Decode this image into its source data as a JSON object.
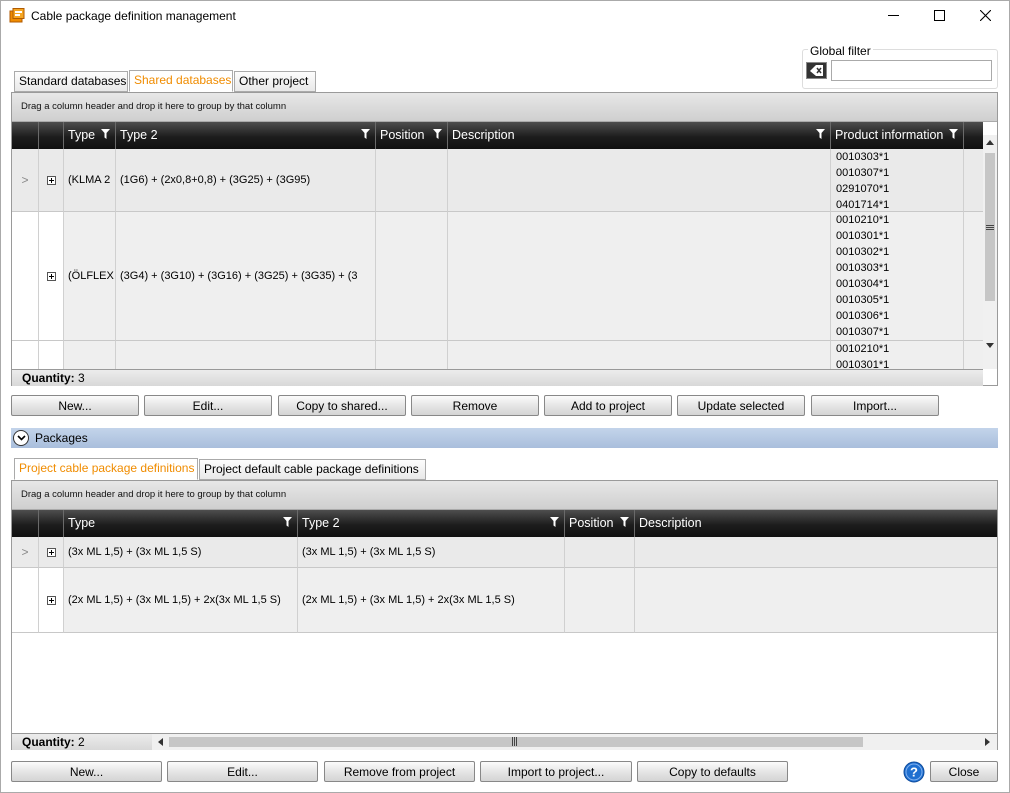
{
  "window": {
    "title": "Cable package definition management",
    "icon": "cable-package-app-icon"
  },
  "global_filter": {
    "label": "Global filter",
    "value": ""
  },
  "top_tabs": [
    {
      "label": "Standard databases",
      "active": false
    },
    {
      "label": "Shared databases",
      "active": true
    },
    {
      "label": "Other project",
      "active": false
    }
  ],
  "top_grid": {
    "group_hint": "Drag a column header and drop it here to group by that column",
    "columns": [
      "Type",
      "Type 2",
      "Position",
      "Description",
      "Product information"
    ],
    "rows": [
      {
        "type": "(KLMA 2",
        "type2": "(1G6) + (2x0,8+0,8) + (3G25) + (3G95)",
        "position": "",
        "description": "",
        "product_info": [
          "0010303*1",
          "0010307*1",
          "0291070*1",
          "0401714*1"
        ]
      },
      {
        "type": "(ÖLFLEX",
        "type2": "(3G4) + (3G10) + (3G16) + (3G25) + (3G35) + (3",
        "position": "",
        "description": "",
        "product_info": [
          "0010210*1",
          "0010301*1",
          "0010302*1",
          "0010303*1",
          "0010304*1",
          "0010305*1",
          "0010306*1",
          "0010307*1"
        ]
      },
      {
        "type": "",
        "type2": "",
        "position": "",
        "description": "",
        "product_info": [
          "0010210*1",
          "0010301*1"
        ]
      }
    ],
    "quantity_label": "Quantity:",
    "quantity_value": "3"
  },
  "top_buttons": [
    "New...",
    "Edit...",
    "Copy to shared...",
    "Remove",
    "Add to project",
    "Update selected",
    "Import..."
  ],
  "packages": {
    "label": "Packages"
  },
  "bottom_tabs": [
    {
      "label": "Project cable package definitions",
      "active": true
    },
    {
      "label": "Project default cable package definitions",
      "active": false
    }
  ],
  "bottom_grid": {
    "group_hint": "Drag a column header and drop it here to group by that column",
    "columns": [
      "Type",
      "Type 2",
      "Position",
      "Description"
    ],
    "rows": [
      {
        "type": "(3x ML 1,5) + (3x ML 1,5 S)",
        "type2": "(3x ML 1,5) + (3x ML 1,5 S)",
        "position": "",
        "description": ""
      },
      {
        "type": "(2x ML 1,5) + (3x ML 1,5) + 2x(3x ML 1,5 S)",
        "type2": "(2x ML 1,5) + (3x ML 1,5) + 2x(3x ML 1,5 S)",
        "position": "",
        "description": ""
      }
    ],
    "quantity_label": "Quantity:",
    "quantity_value": "2"
  },
  "bottom_buttons": [
    "New...",
    "Edit...",
    "Remove from project",
    "Import to project...",
    "Copy to defaults"
  ],
  "close_label": "Close",
  "colors": {
    "active_tab": "#f08c00",
    "header_bg": "#1d1d1d",
    "packages_bar": "#b4c8e2",
    "help_icon": "#1f6fd0"
  }
}
